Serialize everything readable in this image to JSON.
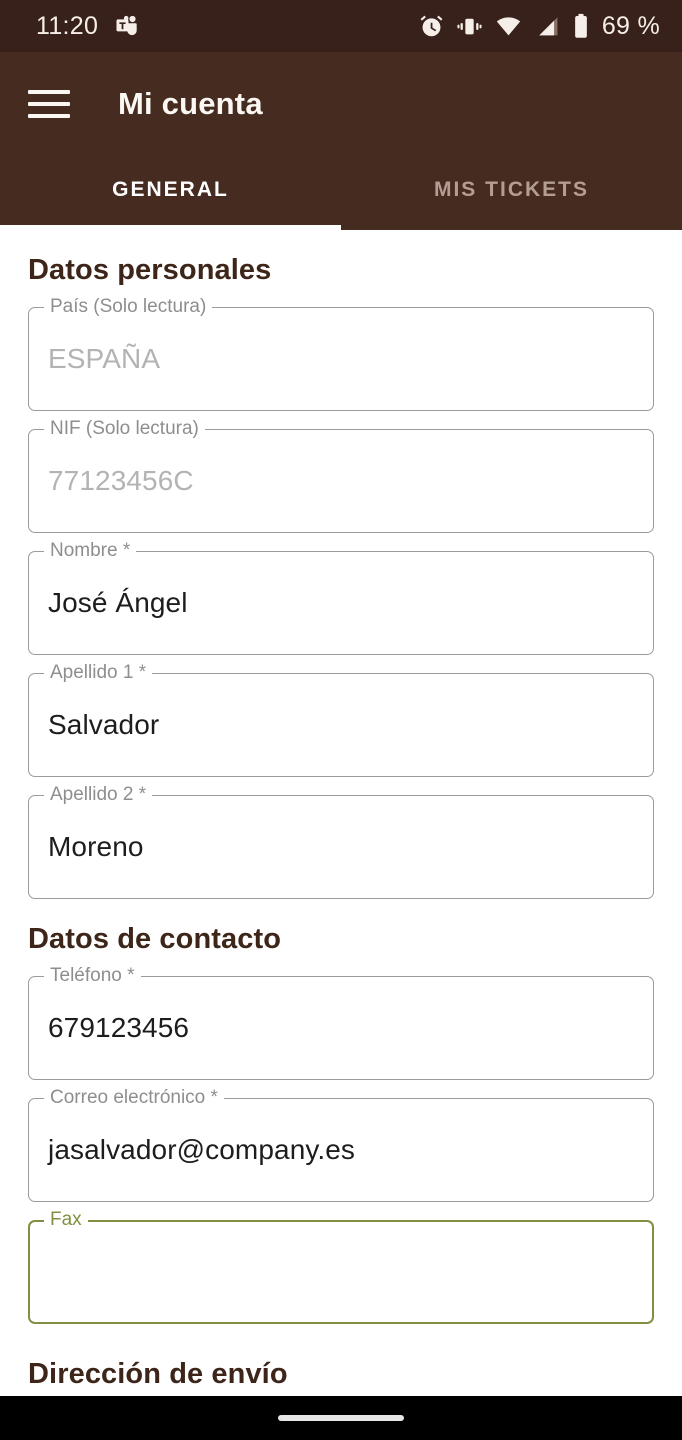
{
  "status_bar": {
    "time": "11:20",
    "battery_text": "69 %",
    "icons": [
      "teams-icon",
      "alarm-icon",
      "vibrate-icon",
      "wifi-icon",
      "cellular-signal-icon",
      "battery-icon"
    ],
    "background_color": "#37211a",
    "foreground_color": "#f6efe9"
  },
  "app_bar": {
    "title": "Mi cuenta",
    "menu_icon": "hamburger-menu-icon",
    "background_color": "#452b20",
    "tabs": [
      {
        "label": "GENERAL",
        "active": true
      },
      {
        "label": "MIS TICKETS",
        "active": false
      }
    ],
    "indicator_color": "#ffffff"
  },
  "content": {
    "sections": [
      {
        "title": "Datos personales",
        "fields": [
          {
            "label": "País (Solo lectura)",
            "value": "ESPAÑA",
            "state": "readonly"
          },
          {
            "label": "NIF (Solo lectura)",
            "value": "77123456C",
            "state": "readonly"
          },
          {
            "label": "Nombre *",
            "value": "José Ángel",
            "state": "normal"
          },
          {
            "label": "Apellido 1 *",
            "value": "Salvador",
            "state": "normal"
          },
          {
            "label": "Apellido 2 *",
            "value": "Moreno",
            "state": "normal"
          }
        ]
      },
      {
        "title": "Datos de contacto",
        "fields": [
          {
            "label": "Teléfono *",
            "value": "679123456",
            "state": "normal"
          },
          {
            "label": "Correo electrónico *",
            "value": "jasalvador@company.es",
            "state": "normal"
          },
          {
            "label": "Fax",
            "value": "",
            "state": "focused"
          }
        ]
      },
      {
        "title": "Dirección de envío",
        "fields": []
      }
    ],
    "heading_color": "#3e2519",
    "focus_color": "#7f9042",
    "border_color": "#9b9b9b",
    "background_color": "#ffffff"
  },
  "nav_bar": {
    "handle": "gesture-home-handle",
    "background_color": "#000000"
  }
}
